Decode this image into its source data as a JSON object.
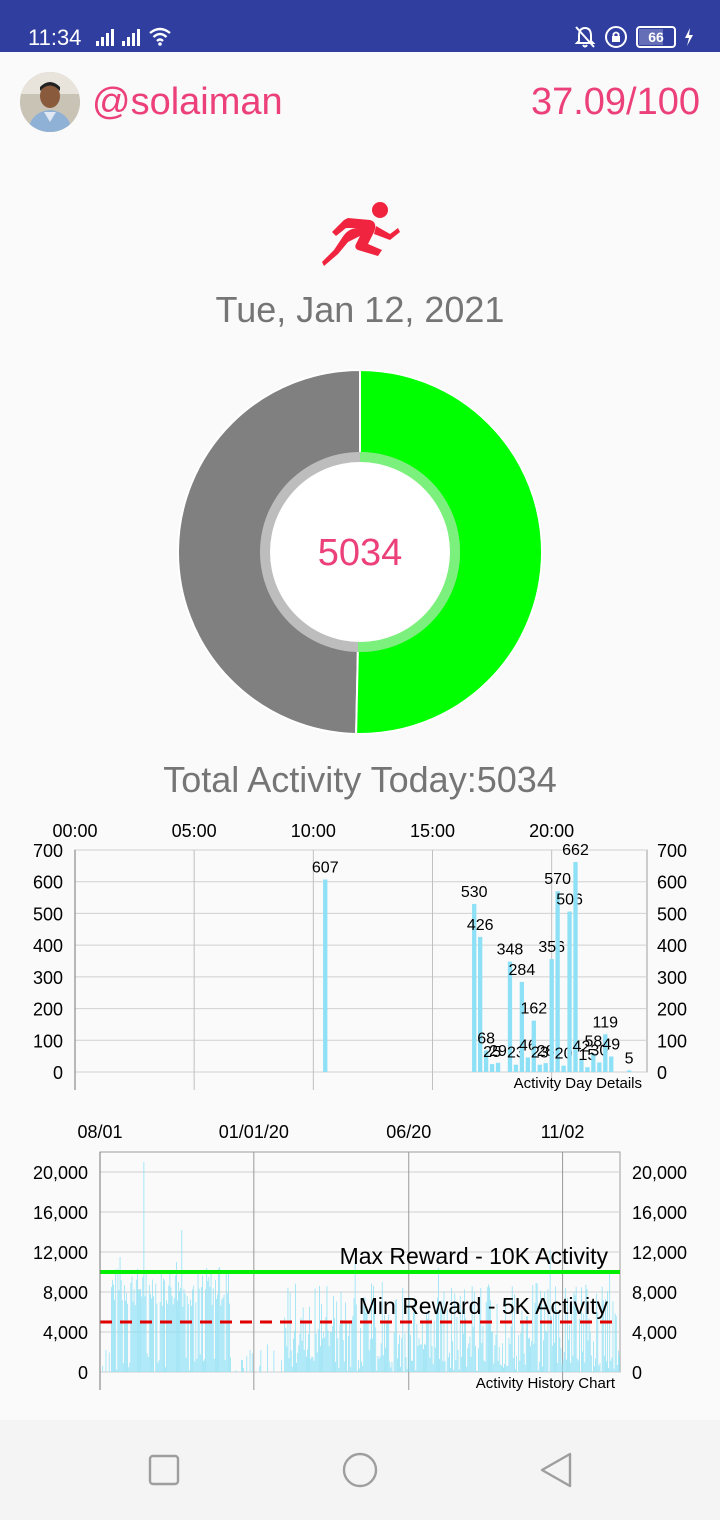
{
  "status_bar": {
    "time": "11:34",
    "battery_level": "66",
    "battery_fraction": 0.66,
    "icons": [
      "signal-icon",
      "signal-icon",
      "wifi-icon",
      "bell-off-icon",
      "lock-rotation-icon",
      "battery-icon",
      "charging-icon"
    ]
  },
  "header": {
    "username": "@solaiman",
    "score": "37.09/100"
  },
  "activity": {
    "date": "Tue, Jan 12, 2021",
    "donut_value": "5034",
    "total_label": "Total Activity Today:5034",
    "progress_fraction": 0.5034
  },
  "colors": {
    "accent": "#ec407a",
    "status_bar": "#303f9f",
    "progress": "#00ff00",
    "remaining": "#808080",
    "bar": "#8de0f5",
    "max_line": "#00ee00",
    "min_line": "#e00000"
  },
  "chart_data": [
    {
      "type": "bar",
      "title": "Activity Day Details",
      "x_unit": "hour of day",
      "xlim": [
        0,
        24
      ],
      "x_ticks": [
        "00:00",
        "05:00",
        "10:00",
        "15:00",
        "20:00"
      ],
      "x_tick_values": [
        0,
        5,
        10,
        15,
        20
      ],
      "ylim": [
        0,
        700
      ],
      "y_ticks": [
        0,
        100,
        200,
        300,
        400,
        500,
        600,
        700
      ],
      "grid": true,
      "bars": [
        {
          "x": 10.5,
          "value": 607
        },
        {
          "x": 16.75,
          "value": 530
        },
        {
          "x": 17.0,
          "value": 426
        },
        {
          "x": 17.25,
          "value": 68
        },
        {
          "x": 17.5,
          "value": 25
        },
        {
          "x": 17.75,
          "value": 29
        },
        {
          "x": 18.25,
          "value": 348
        },
        {
          "x": 18.5,
          "value": 23
        },
        {
          "x": 18.75,
          "value": 284
        },
        {
          "x": 19.0,
          "value": 46
        },
        {
          "x": 19.25,
          "value": 162
        },
        {
          "x": 19.5,
          "value": 23
        },
        {
          "x": 19.75,
          "value": 28
        },
        {
          "x": 20.0,
          "value": 356
        },
        {
          "x": 20.25,
          "value": 570
        },
        {
          "x": 20.5,
          "value": 20
        },
        {
          "x": 20.75,
          "value": 506
        },
        {
          "x": 21.0,
          "value": 662
        },
        {
          "x": 21.25,
          "value": 42
        },
        {
          "x": 21.5,
          "value": 15
        },
        {
          "x": 21.75,
          "value": 58
        },
        {
          "x": 22.0,
          "value": 30
        },
        {
          "x": 22.25,
          "value": 119
        },
        {
          "x": 22.5,
          "value": 49
        },
        {
          "x": 23.25,
          "value": 5
        }
      ],
      "labels_shown": [
        "607",
        "530",
        "426",
        "68",
        "25",
        "29",
        "348",
        "23",
        "284",
        "46",
        "162",
        "23",
        "28",
        "356",
        "570",
        "20",
        "506",
        "662",
        "42",
        "15",
        "58",
        "30",
        "119",
        "49",
        "5"
      ]
    },
    {
      "type": "bar",
      "title": "Activity History Chart",
      "x_ticks": [
        "08/01",
        "01/01/20",
        "06/20",
        "11/02"
      ],
      "ylim": [
        0,
        22000
      ],
      "y_ticks": [
        0,
        4000,
        8000,
        12000,
        16000,
        20000
      ],
      "y_tick_labels": [
        "0",
        "4,000",
        "8,000",
        "12,000",
        "16,000",
        "20,000"
      ],
      "grid": true,
      "limit_lines": [
        {
          "label": "Max Reward - 10K Activity",
          "value": 10000,
          "style": "solid",
          "color": "#00ee00"
        },
        {
          "label": "Min Reward - 5K Activity",
          "value": 5000,
          "style": "dashed",
          "color": "#e00000"
        }
      ],
      "num_days": 480,
      "approx_peaks": [
        {
          "day": 40,
          "value": 21000
        },
        {
          "day": 75,
          "value": 14200
        },
        {
          "day": 18,
          "value": 11500
        },
        {
          "day": 70,
          "value": 11000
        },
        {
          "day": 110,
          "value": 10500
        },
        {
          "day": 235,
          "value": 11000
        },
        {
          "day": 312,
          "value": 10400
        },
        {
          "day": 415,
          "value": 12200
        },
        {
          "day": 470,
          "value": 10000
        }
      ]
    }
  ]
}
